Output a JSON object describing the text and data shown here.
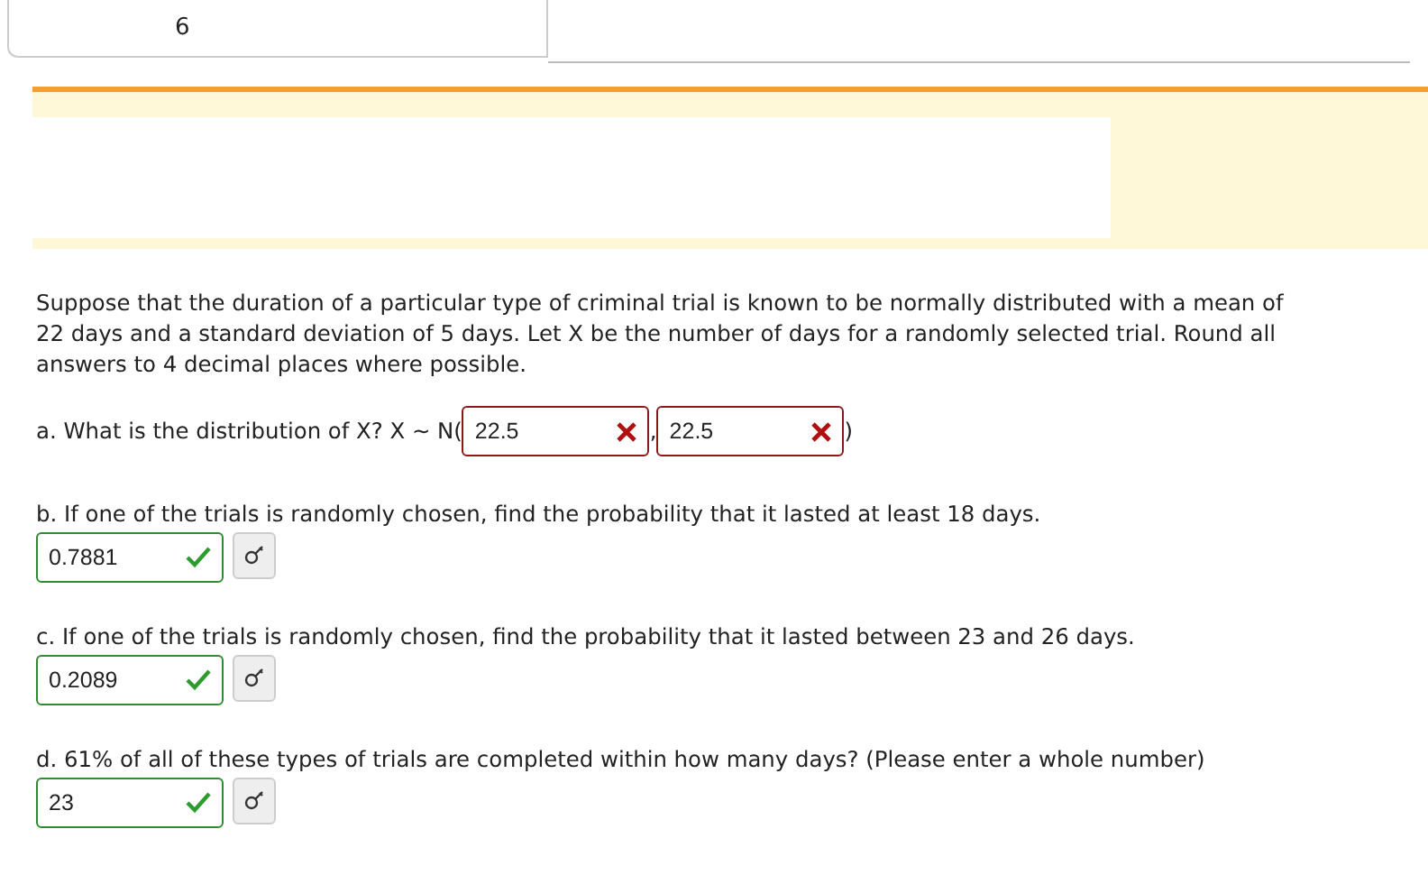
{
  "header": {
    "number": "6"
  },
  "question": {
    "intro": "Suppose that the duration of a particular type of criminal trial is known to be normally distributed with a mean of 22 days and a standard deviation of 5 days. Let X be the number of days for a randomly selected trial. Round all answers to 4 decimal places where possible.",
    "part_a": {
      "prompt": "a. What is the distribution of X? X ~ N(",
      "separator": ",",
      "closing": ")",
      "answers": [
        {
          "value": "22.5",
          "correct": false
        },
        {
          "value": "22.5",
          "correct": false
        }
      ]
    },
    "parts": [
      {
        "prompt": "b. If one of the trials is randomly chosen, find the probability that it lasted at least 18 days.",
        "answer": {
          "value": "0.7881",
          "correct": true
        }
      },
      {
        "prompt": "c. If one of the trials is randomly chosen, find the probability that it lasted between 23 and 26 days.",
        "answer": {
          "value": "0.2089",
          "correct": true
        }
      },
      {
        "prompt": "d. 61% of all of these types of trials are completed within how many days? (Please enter a whole number)",
        "answer": {
          "value": "23",
          "correct": true
        }
      }
    ]
  }
}
